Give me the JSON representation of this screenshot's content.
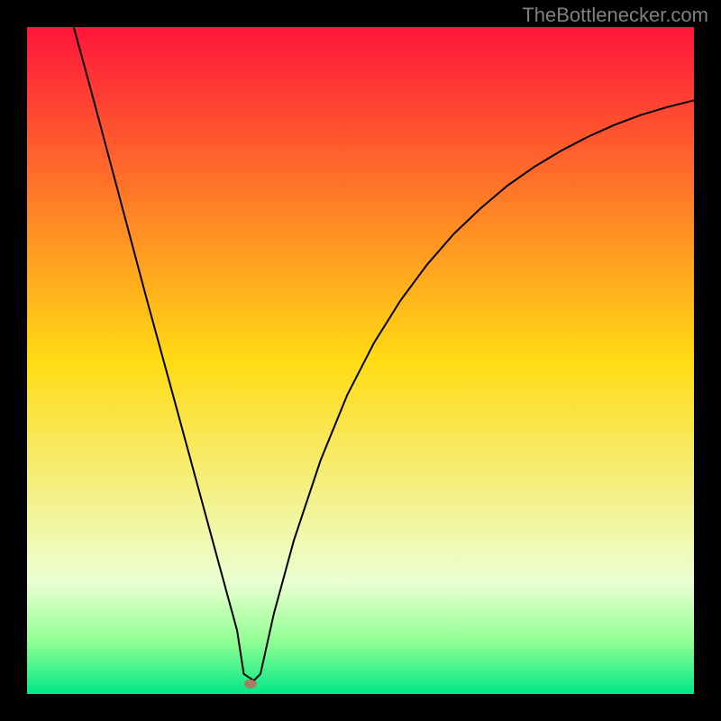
{
  "watermark": "TheBottlenecker.com",
  "colors": {
    "top": "#ff163c",
    "mid": "#ffdb13",
    "green_pale": "#ecffd2",
    "green_mid": "#93ff93",
    "green_deep": "#00e887",
    "curve": "#000000",
    "marker": "#c26a5a",
    "frame": "#000000"
  },
  "chart_data": {
    "type": "line",
    "title": "",
    "xlabel": "",
    "ylabel": "",
    "xlim": [
      0,
      100
    ],
    "ylim": [
      0,
      100
    ],
    "min_point": {
      "x": 33.5,
      "y": 1.5
    },
    "curve": [
      {
        "x": 7.0,
        "y": 100.0
      },
      {
        "x": 10.0,
        "y": 89.0
      },
      {
        "x": 14.0,
        "y": 74.0
      },
      {
        "x": 18.0,
        "y": 59.0
      },
      {
        "x": 22.0,
        "y": 44.4
      },
      {
        "x": 26.0,
        "y": 29.7
      },
      {
        "x": 30.0,
        "y": 15.0
      },
      {
        "x": 31.5,
        "y": 9.5
      },
      {
        "x": 32.5,
        "y": 3.0
      },
      {
        "x": 34.0,
        "y": 2.0
      },
      {
        "x": 35.0,
        "y": 3.0
      },
      {
        "x": 37.0,
        "y": 12.0
      },
      {
        "x": 40.0,
        "y": 23.0
      },
      {
        "x": 44.0,
        "y": 35.0
      },
      {
        "x": 48.0,
        "y": 44.8
      },
      {
        "x": 52.0,
        "y": 52.6
      },
      {
        "x": 56.0,
        "y": 59.0
      },
      {
        "x": 60.0,
        "y": 64.4
      },
      {
        "x": 64.0,
        "y": 69.0
      },
      {
        "x": 68.0,
        "y": 72.8
      },
      {
        "x": 72.0,
        "y": 76.2
      },
      {
        "x": 76.0,
        "y": 79.0
      },
      {
        "x": 80.0,
        "y": 81.4
      },
      {
        "x": 84.0,
        "y": 83.5
      },
      {
        "x": 88.0,
        "y": 85.3
      },
      {
        "x": 92.0,
        "y": 86.8
      },
      {
        "x": 96.0,
        "y": 88.0
      },
      {
        "x": 100.0,
        "y": 89.0
      }
    ]
  }
}
